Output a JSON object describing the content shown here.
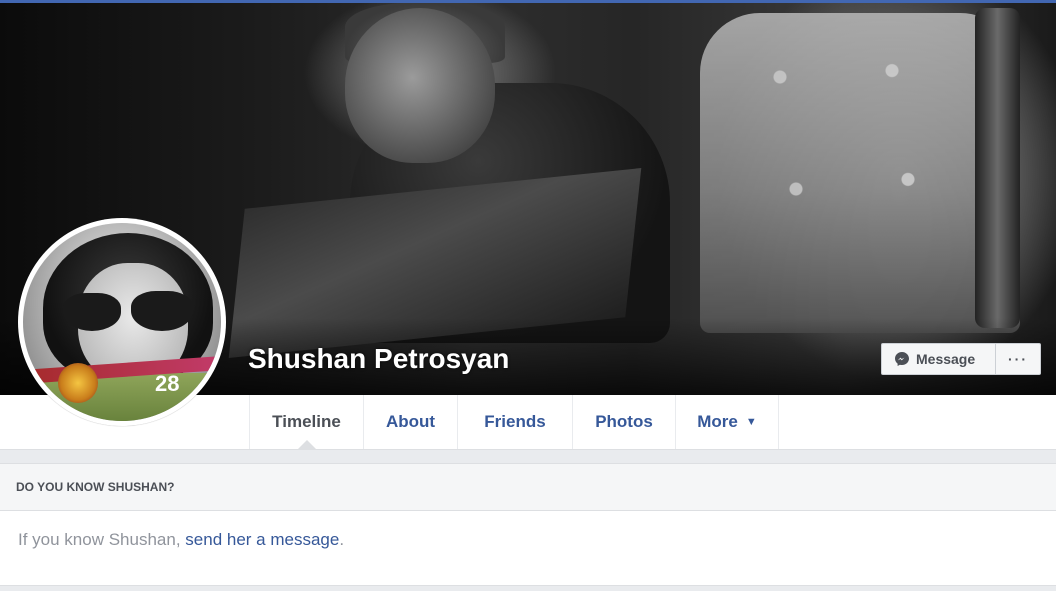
{
  "profile": {
    "name": "Shushan Petrosyan",
    "avatar_badge": "28"
  },
  "cover_actions": {
    "message_label": "Message",
    "more_label": "···"
  },
  "tabs": [
    {
      "label": "Timeline",
      "active": true
    },
    {
      "label": "About"
    },
    {
      "label": "Friends"
    },
    {
      "label": "Photos"
    },
    {
      "label": "More",
      "icon": "caret-down-icon"
    }
  ],
  "know_card": {
    "header": "DO YOU KNOW SHUSHAN?",
    "text_before": "If you know Shushan, ",
    "link": "send her a message",
    "text_after": "."
  },
  "colors": {
    "link": "#365899",
    "accent": "#4267b2",
    "page_bg": "#e9ebee"
  }
}
